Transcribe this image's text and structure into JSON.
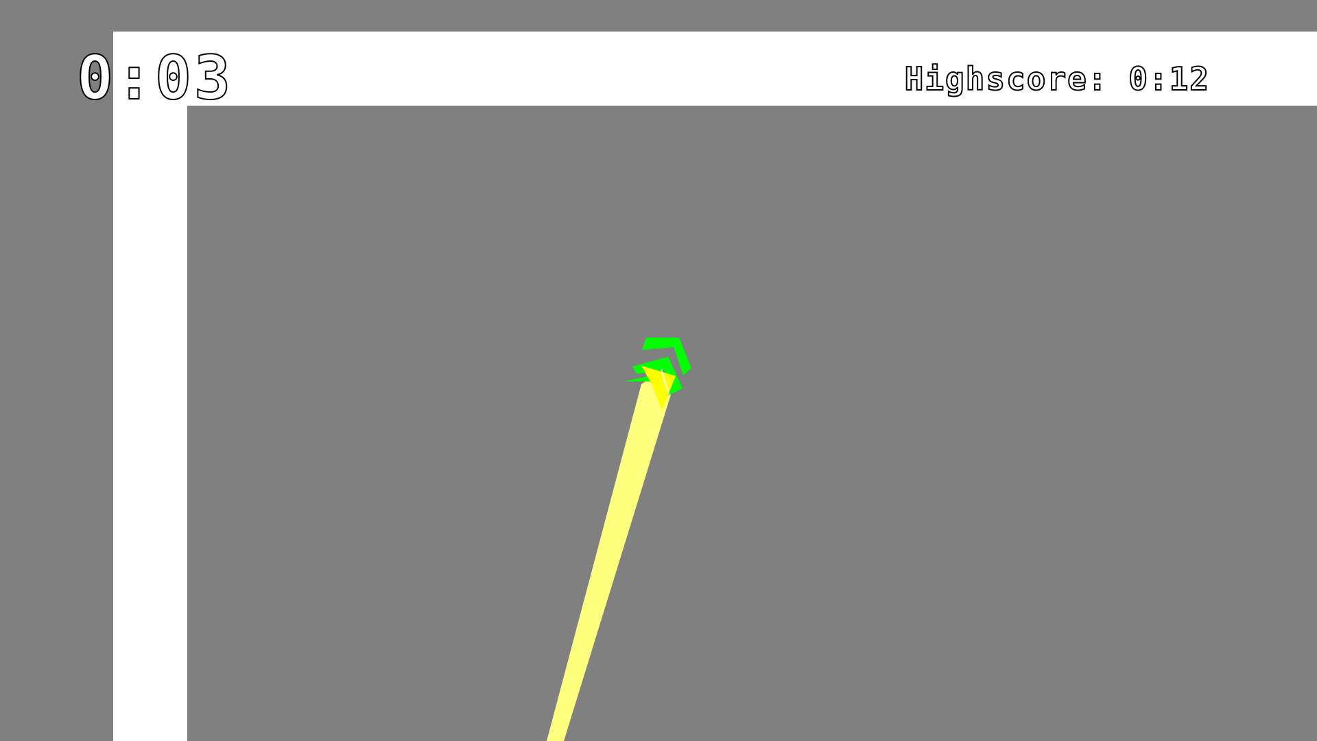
{
  "colors": {
    "background": "#808080",
    "wall": "#ffffff",
    "trail": "#ffff80",
    "player_arrow": "#00ff00",
    "player_body": "#ffff00",
    "text_fill": "#ffffff",
    "text_stroke": "#000000"
  },
  "hud": {
    "timer": "0:03",
    "highscore": "Highscore: 0:12"
  },
  "player": {
    "icon": "triple-chevron-arrow-icon",
    "heading": "up-right"
  }
}
